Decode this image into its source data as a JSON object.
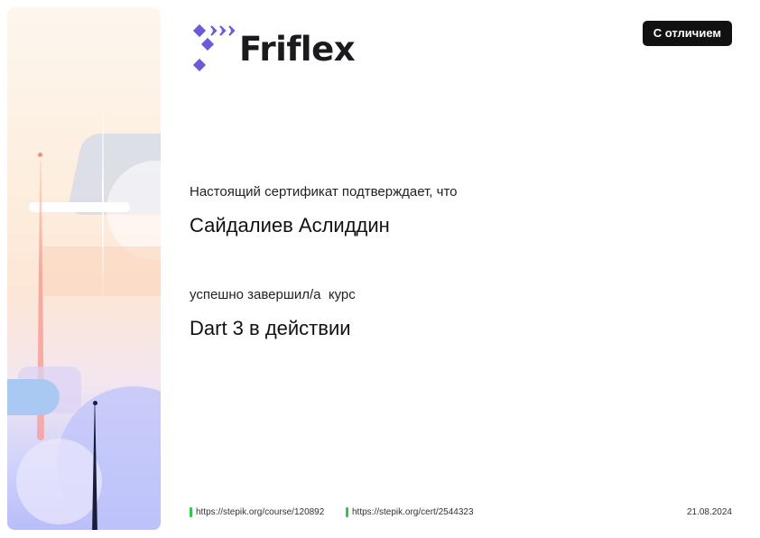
{
  "brand": {
    "name": "Friflex",
    "accent_color": "#6a5bd6"
  },
  "badge": {
    "label": "С отличием"
  },
  "certificate": {
    "intro": "Настоящий сертификат подтверждает, что",
    "recipient": "Сайдалиев Аслиддин",
    "course_intro": "успешно завершил/а  курс",
    "course_title": "Dart 3 в действии"
  },
  "footer": {
    "course_link": "https://stepik.org/course/120892",
    "cert_link": "https://stepik.org/cert/2544323",
    "date": "21.08.2024",
    "link_marker_color": "#3ac44f"
  }
}
